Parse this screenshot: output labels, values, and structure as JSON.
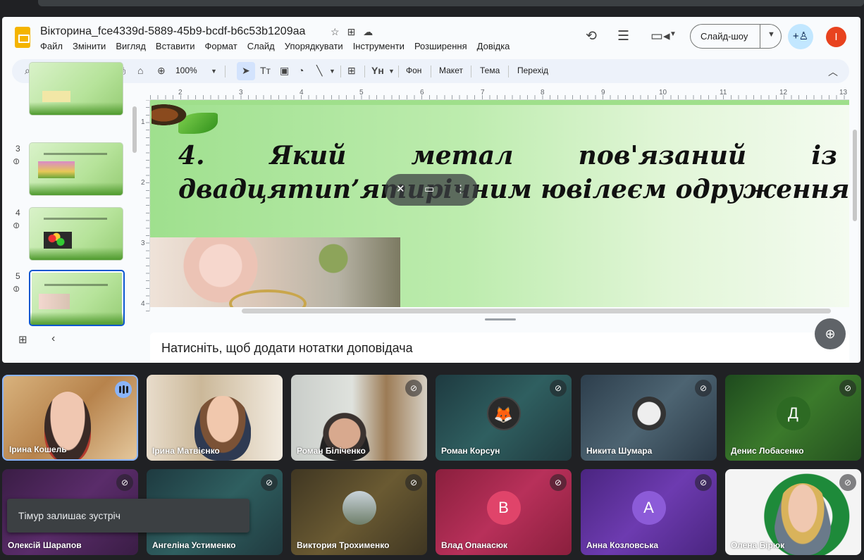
{
  "slides_app": {
    "doc_title": "Вікторина_fce4339d-5889-45b9-bcdf-b6c53b1209aa",
    "menu": [
      "Файл",
      "Змінити",
      "Вигляд",
      "Вставити",
      "Формат",
      "Слайд",
      "Упорядкувати",
      "Інструменти",
      "Розширення",
      "Довідка"
    ],
    "slideshow_label": "Слайд-шоу",
    "avatar_letter": "I",
    "toolbar": {
      "zoom": "100%",
      "background": "Фон",
      "layout": "Макет",
      "theme": "Тема",
      "transition": "Перехід"
    },
    "icons": [
      "star-icon",
      "move-to-folder-icon",
      "cloud-saved-icon",
      "history-icon",
      "comment-icon",
      "camera-icon",
      "add-person-icon"
    ],
    "ruler_numbers": [
      "2",
      "3",
      "4",
      "5",
      "6",
      "7",
      "8",
      "9",
      "10",
      "11",
      "12",
      "13"
    ],
    "vruler_numbers": [
      "1",
      "2",
      "3",
      "4"
    ],
    "thumb_numbers": [
      "3",
      "4",
      "5"
    ],
    "selected_slide": 5,
    "slide": {
      "line1_words": [
        "4.",
        "Який",
        "метал",
        "пов'язаний",
        "із"
      ],
      "line2": "двадцятип’ятирічним ювілеєм одруження?"
    },
    "notes_placeholder": "Натисніть, щоб додати нотатки доповідача"
  },
  "meet": {
    "participants": [
      {
        "name": "Ірина Кошель",
        "state": "speaking"
      },
      {
        "name": "Ірина Матвієнко",
        "state": "video"
      },
      {
        "name": "Роман Біліченко",
        "state": "muted"
      },
      {
        "name": "Роман Корсун",
        "state": "muted"
      },
      {
        "name": "Никита Шумара",
        "state": "muted"
      },
      {
        "name": "Денис Лобасенко",
        "state": "muted",
        "initial": "Д"
      },
      {
        "name": "Олексій Шарапов",
        "state": "muted"
      },
      {
        "name": "Ангеліна Устименко",
        "state": "muted"
      },
      {
        "name": "Виктория Трохименко",
        "state": "muted"
      },
      {
        "name": "Влад Опанасюк",
        "state": "muted",
        "initial": "В"
      },
      {
        "name": "Анна Козловська",
        "state": "muted",
        "initial": "А"
      },
      {
        "name": "Олена Бірюк",
        "state": "muted"
      }
    ],
    "toast": "Тімур залишає зустріч"
  },
  "colors": {
    "accent_blue": "#0b57d0",
    "slides_yellow": "#f4b400",
    "avatar_red": "#e8431f",
    "meet_bg": "#202124"
  }
}
